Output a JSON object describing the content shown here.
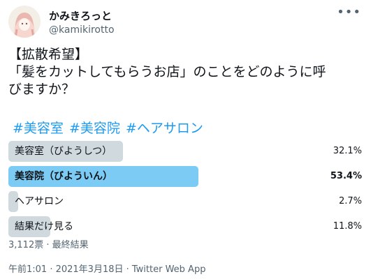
{
  "author": {
    "name": "かみきろっと",
    "handle": "@kamikirotto",
    "avatar_icon": "anime-girl-avatar"
  },
  "more_icon": "more-options-icon",
  "tweet_lines": [
    "【拡散希望】",
    "「髪をカットしてもらうお店」のことをどのように呼",
    "びますか？"
  ],
  "hashtags": "#美容室 #美容院 #ヘアサロン",
  "poll": {
    "options": [
      {
        "label": "美容室（びようしつ）",
        "percent_text": "32.1%",
        "percent": 32.1,
        "winner": false
      },
      {
        "label": "美容院（びよういん）",
        "percent_text": "53.4%",
        "percent": 53.4,
        "winner": true
      },
      {
        "label": "ヘアサロン",
        "percent_text": "2.7%",
        "percent": 2.7,
        "winner": false
      },
      {
        "label": "結果だけ見る",
        "percent_text": "11.8%",
        "percent": 11.8,
        "winner": false
      }
    ],
    "summary": "3,112票 · 最終結果"
  },
  "timestamp": "午前1:01 · 2021年3月18日 · Twitter Web App",
  "colors": {
    "accent": "#1d9bf0",
    "winner_bar": "#7ccbf5",
    "bar": "#cfd9de"
  }
}
